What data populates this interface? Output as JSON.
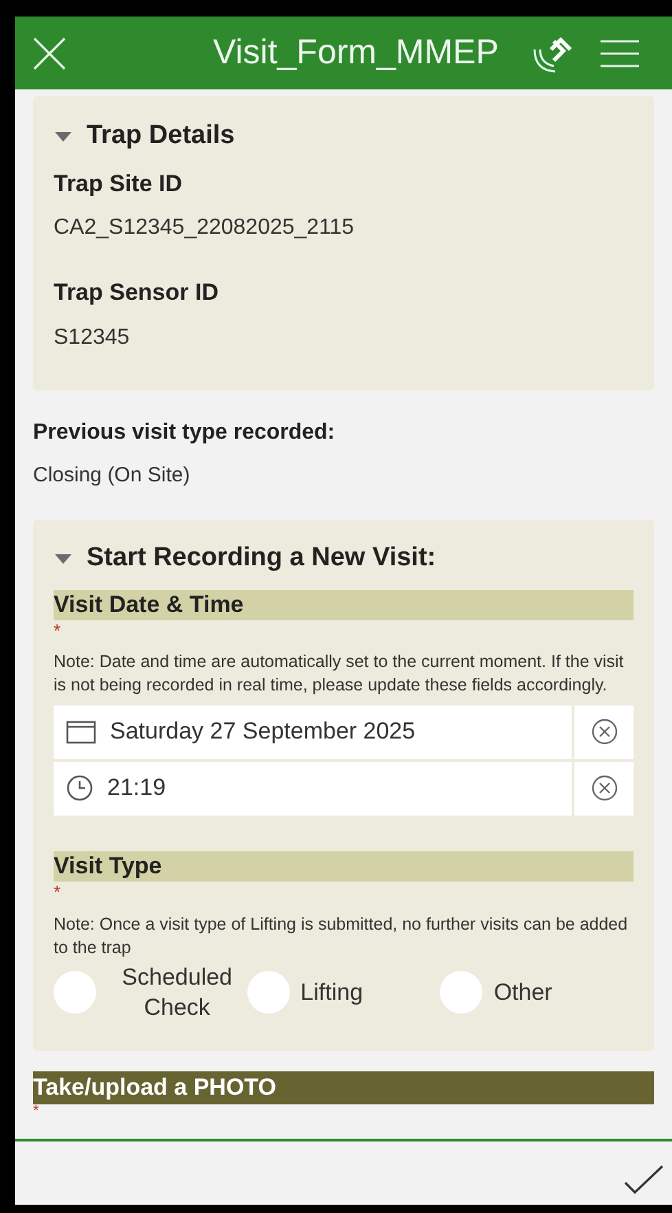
{
  "header": {
    "title": "Visit_Form_MMEP"
  },
  "trap_details": {
    "title": "Trap Details",
    "expanded": true,
    "fields": [
      {
        "label": "Trap Site ID",
        "value": "CA2_S12345_22082025_2115"
      },
      {
        "label": "Trap Sensor ID",
        "value": "S12345"
      }
    ]
  },
  "previous_visit": {
    "label": "Previous visit type recorded:",
    "value": "Closing (On Site)"
  },
  "new_visit": {
    "title": "Start Recording a New Visit:",
    "expanded": true,
    "date_time": {
      "label": "Visit Date & Time",
      "required": "*",
      "note": "Note: Date and time are automatically set to the current moment. If the visit is not being recorded in real time, please update these fields accordingly.",
      "inputs": [
        {
          "kind": "date",
          "value": "Saturday 27 September 2025"
        },
        {
          "kind": "time",
          "value": "21:19"
        }
      ]
    },
    "visit_type": {
      "label": "Visit Type",
      "required": "*",
      "note": "Note: Once a visit type of Lifting is submitted, no further visits can be added to the trap",
      "options": [
        {
          "label": "Scheduled Check",
          "selected": false
        },
        {
          "label": "Lifting",
          "selected": false
        },
        {
          "label": "Other",
          "selected": false
        }
      ]
    }
  },
  "photo": {
    "label": "Take/upload a PHOTO",
    "required": "*"
  }
}
